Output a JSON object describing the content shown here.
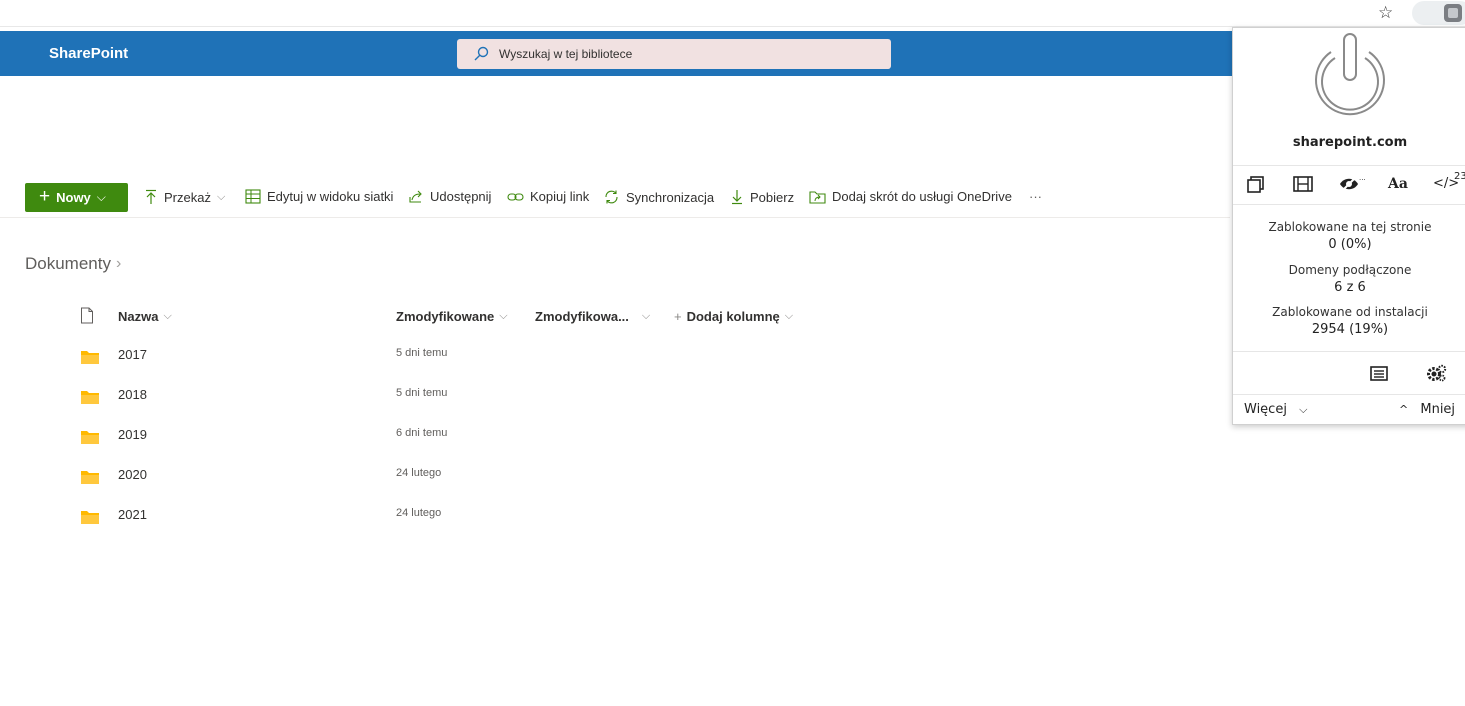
{
  "suitebar": {
    "brand": "SharePoint",
    "search_placeholder": "Wyszukaj w tej bibliotece"
  },
  "commands": {
    "new": "Nowy",
    "upload": "Przekaż",
    "grid_edit": "Edytuj w widoku siatki",
    "share": "Udostępnij",
    "copy_link": "Kopiuj link",
    "sync": "Synchronizacja",
    "download": "Pobierz",
    "onedrive_shortcut": "Dodaj skrót do usługi OneDrive",
    "more": "···"
  },
  "breadcrumb": {
    "root": "Dokumenty"
  },
  "list": {
    "columns": {
      "name": "Nazwa",
      "modified": "Zmodyfikowane",
      "modified_by": "Zmodyfikowa...",
      "add_column": "Dodaj kolumnę"
    },
    "rows": [
      {
        "name": "2017",
        "modified": "5 dni temu"
      },
      {
        "name": "2018",
        "modified": "5 dni temu"
      },
      {
        "name": "2019",
        "modified": "6 dni temu"
      },
      {
        "name": "2020",
        "modified": "24 lutego"
      },
      {
        "name": "2021",
        "modified": "24 lutego"
      }
    ]
  },
  "extension": {
    "domain": "sharepoint.com",
    "scripts_count": "23",
    "blocked_page_label": "Zablokowane na tej stronie",
    "blocked_page_value": "0 (0%)",
    "domains_label": "Domeny podłączone",
    "domains_value": "6 z 6",
    "blocked_total_label": "Zablokowane od instalacji",
    "blocked_total_value": "2954 (19%)",
    "more": "Więcej",
    "less": "Mniej"
  },
  "colors": {
    "suitebar": "#1f72b7",
    "new_button": "#3f8a0f",
    "accent_green": "#3f8a0f",
    "folder": "#ffb900"
  }
}
